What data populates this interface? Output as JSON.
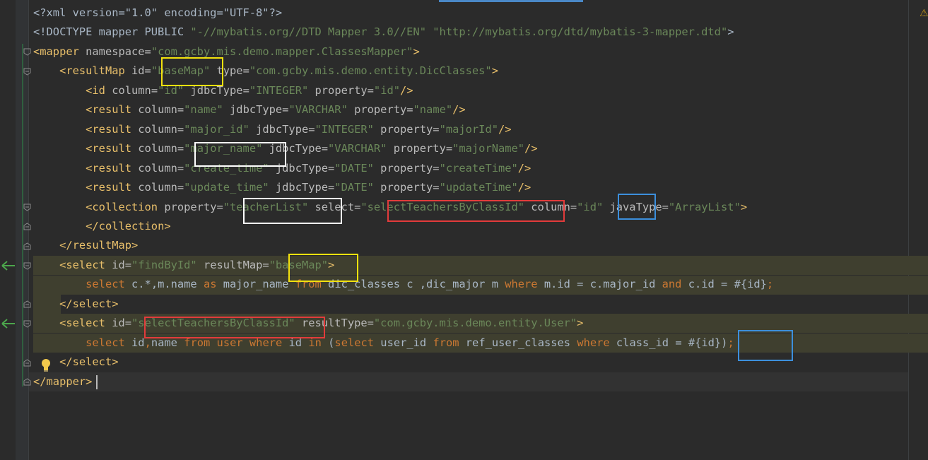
{
  "editor": {
    "lines": [
      {
        "segs": [
          [
            "p",
            "<?xml version=\"1.0\" encoding=\"UTF-8\"?>"
          ]
        ]
      },
      {
        "segs": [
          [
            "p",
            "<!DOCTYPE mapper PUBLIC "
          ],
          [
            "s",
            "\"-//mybatis.org//DTD Mapper 3.0//EN\""
          ],
          [
            "p",
            " "
          ],
          [
            "s",
            "\"http://mybatis.org/dtd/mybatis-3-mapper.dtd\""
          ],
          [
            "p",
            ">"
          ]
        ]
      },
      {
        "segs": [
          [
            "t",
            "<mapper"
          ],
          [
            "a",
            " namespace="
          ],
          [
            "s",
            "\"com.gcby.mis.demo.mapper.ClassesMapper\""
          ],
          [
            "t",
            ">"
          ]
        ]
      },
      {
        "segs": [
          [
            "p",
            "    "
          ],
          [
            "t",
            "<resultMap"
          ],
          [
            "a",
            " id="
          ],
          [
            "s",
            "\"baseMap\""
          ],
          [
            "a",
            " type="
          ],
          [
            "s",
            "\"com.gcby.mis.demo.entity.DicClasses\""
          ],
          [
            "t",
            ">"
          ]
        ]
      },
      {
        "segs": [
          [
            "p",
            "        "
          ],
          [
            "t",
            "<id"
          ],
          [
            "a",
            " column="
          ],
          [
            "s",
            "\"id\""
          ],
          [
            "a",
            " jdbcType="
          ],
          [
            "s",
            "\"INTEGER\""
          ],
          [
            "a",
            " property="
          ],
          [
            "s",
            "\"id\""
          ],
          [
            "t",
            "/>"
          ]
        ]
      },
      {
        "segs": [
          [
            "p",
            "        "
          ],
          [
            "t",
            "<result"
          ],
          [
            "a",
            " column="
          ],
          [
            "s",
            "\"name\""
          ],
          [
            "a",
            " jdbcType="
          ],
          [
            "s",
            "\"VARCHAR\""
          ],
          [
            "a",
            " property="
          ],
          [
            "s",
            "\"name\""
          ],
          [
            "t",
            "/>"
          ]
        ]
      },
      {
        "segs": [
          [
            "p",
            "        "
          ],
          [
            "t",
            "<result"
          ],
          [
            "a",
            " column="
          ],
          [
            "s",
            "\"major_id\""
          ],
          [
            "a",
            " jdbcType="
          ],
          [
            "s",
            "\"INTEGER\""
          ],
          [
            "a",
            " property="
          ],
          [
            "s",
            "\"majorId\""
          ],
          [
            "t",
            "/>"
          ]
        ]
      },
      {
        "segs": [
          [
            "p",
            "        "
          ],
          [
            "t",
            "<result"
          ],
          [
            "a",
            " column="
          ],
          [
            "s",
            "\"major_name\""
          ],
          [
            "a",
            " jdbcType="
          ],
          [
            "s",
            "\"VARCHAR\""
          ],
          [
            "a",
            " property="
          ],
          [
            "s",
            "\"majorName\""
          ],
          [
            "t",
            "/>"
          ]
        ]
      },
      {
        "segs": [
          [
            "p",
            "        "
          ],
          [
            "t",
            "<result"
          ],
          [
            "a",
            " column="
          ],
          [
            "s",
            "\"create_time\""
          ],
          [
            "a",
            " jdbcType="
          ],
          [
            "s",
            "\"DATE\""
          ],
          [
            "a",
            " property="
          ],
          [
            "s",
            "\"createTime\""
          ],
          [
            "t",
            "/>"
          ]
        ]
      },
      {
        "segs": [
          [
            "p",
            "        "
          ],
          [
            "t",
            "<result"
          ],
          [
            "a",
            " column="
          ],
          [
            "s",
            "\"update_time\""
          ],
          [
            "a",
            " jdbcType="
          ],
          [
            "s",
            "\"DATE\""
          ],
          [
            "a",
            " property="
          ],
          [
            "s",
            "\"updateTime\""
          ],
          [
            "t",
            "/>"
          ]
        ]
      },
      {
        "segs": [
          [
            "p",
            "        "
          ],
          [
            "t",
            "<collection"
          ],
          [
            "a",
            " property="
          ],
          [
            "s",
            "\"teacherList\""
          ],
          [
            "a",
            " select="
          ],
          [
            "s",
            "\"selectTeachersByClassId\""
          ],
          [
            "a",
            " column="
          ],
          [
            "s",
            "\"id\""
          ],
          [
            "a",
            " javaType="
          ],
          [
            "s",
            "\"ArrayList\""
          ],
          [
            "t",
            ">"
          ]
        ]
      },
      {
        "segs": [
          [
            "p",
            "        "
          ],
          [
            "t",
            "</collection>"
          ]
        ]
      },
      {
        "segs": [
          [
            "p",
            "    "
          ],
          [
            "t",
            "</resultMap>"
          ]
        ]
      },
      {
        "segs": [
          [
            "p",
            "    "
          ],
          [
            "t",
            "<select"
          ],
          [
            "a",
            " id="
          ],
          [
            "s",
            "\"findById\""
          ],
          [
            "a",
            " resultMap="
          ],
          [
            "s",
            "\"baseMap\""
          ],
          [
            "t",
            ">"
          ]
        ]
      },
      {
        "segs": [
          [
            "p",
            "        "
          ],
          [
            "k",
            "select"
          ],
          [
            "p",
            " c.*,m.name "
          ],
          [
            "k",
            "as"
          ],
          [
            "p",
            " major_name "
          ],
          [
            "k",
            "from"
          ],
          [
            "p",
            " dic_classes c ,dic_major m "
          ],
          [
            "k",
            "where"
          ],
          [
            "p",
            " m.id = c.major_id "
          ],
          [
            "k",
            "and"
          ],
          [
            "p",
            " c.id = #{id}"
          ],
          [
            "k",
            ";"
          ]
        ]
      },
      {
        "segs": [
          [
            "p",
            "    "
          ],
          [
            "t",
            "</select>"
          ]
        ]
      },
      {
        "segs": [
          [
            "p",
            "    "
          ],
          [
            "t",
            "<select"
          ],
          [
            "a",
            " id="
          ],
          [
            "s",
            "\"selectTeachersByClassId\""
          ],
          [
            "a",
            " resultType="
          ],
          [
            "s",
            "\"com.gcby.mis.demo.entity.User\""
          ],
          [
            "t",
            ">"
          ]
        ]
      },
      {
        "segs": [
          [
            "p",
            "        "
          ],
          [
            "k",
            "select"
          ],
          [
            "p",
            " id"
          ],
          [
            "k",
            ","
          ],
          [
            "p",
            "name "
          ],
          [
            "k",
            "from"
          ],
          [
            "p",
            " "
          ],
          [
            "k",
            "user"
          ],
          [
            "p",
            " "
          ],
          [
            "k",
            "where"
          ],
          [
            "p",
            " id "
          ],
          [
            "k",
            "in"
          ],
          [
            "p",
            " ("
          ],
          [
            "k",
            "select"
          ],
          [
            "p",
            " user_id "
          ],
          [
            "k",
            "from"
          ],
          [
            "p",
            " ref_user_classes "
          ],
          [
            "k",
            "where"
          ],
          [
            "p",
            " class_id = #{id})"
          ],
          [
            "k",
            ";"
          ]
        ]
      },
      {
        "segs": [
          [
            "p",
            "    "
          ],
          [
            "t",
            "</select>"
          ]
        ]
      },
      {
        "segs": [
          [
            "t",
            "</mapper>"
          ]
        ]
      }
    ]
  },
  "colors": {
    "background": "#2b2b2b",
    "tag": "#e8bf6a",
    "attribute": "#bababa",
    "string": "#6a8759",
    "keyword": "#cc7832",
    "plain": "#a9b7c6",
    "annotation_yellow": "#f3e20e",
    "annotation_white": "#ffffff",
    "annotation_red": "#e23b3b",
    "annotation_blue": "#3c8fdc"
  },
  "icons": {
    "gutter_arrows": "navigate-to-implementation-icon",
    "intention": "lightbulb-icon",
    "warning": "warning-icon",
    "fold": "fold-marker-icon"
  }
}
